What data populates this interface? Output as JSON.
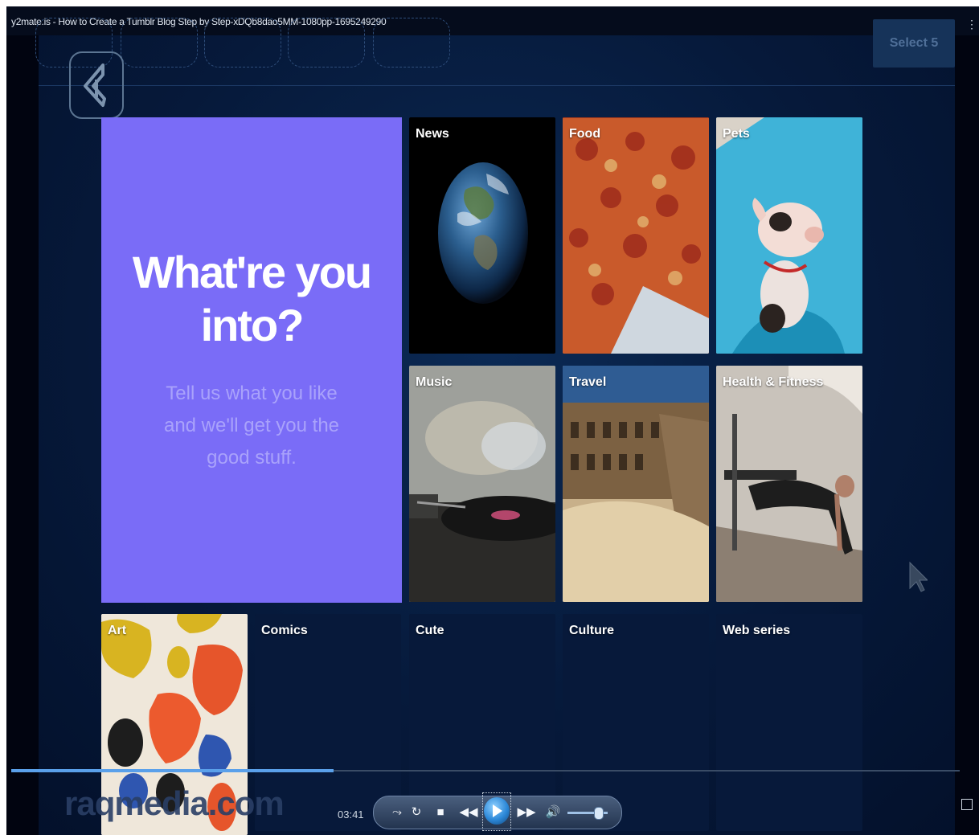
{
  "window": {
    "video_title": "y2mate.is - How to Create a Tumblr Blog Step by Step-xDQb8dao5MM-1080pp-1695249290"
  },
  "header": {
    "select_button": "Select 5"
  },
  "hero": {
    "title": "What're you into?",
    "subtitle": "Tell us what you like and we'll get you the good stuff."
  },
  "categories": [
    {
      "label": "News"
    },
    {
      "label": "Food"
    },
    {
      "label": "Pets"
    },
    {
      "label": "Music"
    },
    {
      "label": "Travel"
    },
    {
      "label": "Health & Fitness"
    },
    {
      "label": "Art"
    },
    {
      "label": "Comics"
    },
    {
      "label": "Cute"
    },
    {
      "label": "Culture"
    },
    {
      "label": "Web series"
    }
  ],
  "watermark": "raqmedia.com",
  "player": {
    "time": "03:41",
    "progress_fraction": 0.34,
    "volume_fraction": 0.75,
    "icons": [
      "shuffle-icon",
      "repeat-icon",
      "stop-icon",
      "previous-icon",
      "play-icon",
      "next-icon",
      "volume-icon",
      "fullscreen-icon"
    ]
  }
}
